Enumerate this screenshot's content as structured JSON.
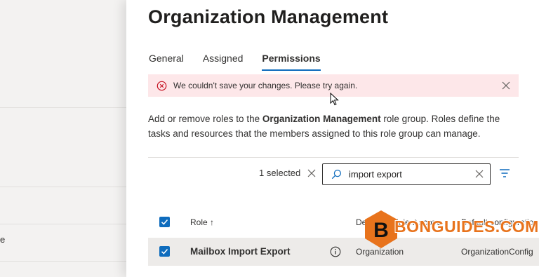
{
  "background_page": {
    "partial_text": "e"
  },
  "panel": {
    "title": "Organization Management",
    "tabs": [
      {
        "label": "General",
        "active": false
      },
      {
        "label": "Assigned",
        "active": false
      },
      {
        "label": "Permissions",
        "active": true
      }
    ],
    "error": {
      "message": "We couldn't save your changes. Please try again."
    },
    "description": {
      "prefix": "Add or remove roles to the ",
      "bold": "Organization Management",
      "suffix": " role group. Roles define the tasks and resources that the members assigned to this role group can manage."
    },
    "toolbar": {
      "selected_text": "1 selected",
      "search_value": "import export"
    },
    "table": {
      "headers": {
        "role": "Role ↑",
        "scope": "Default recipient scope",
        "config": "Default configuration"
      },
      "rows": [
        {
          "role": "Mailbox Import Export",
          "scope": "Organization",
          "config": "OrganizationConfig",
          "selected": true
        }
      ]
    }
  },
  "watermark": {
    "text": "BONGUIDES.COM",
    "letter": "B"
  },
  "colors": {
    "accent": "#0f6cbd",
    "error_bg": "#fde7e9",
    "error_icon": "#c50f1f",
    "watermark": "#e8731c"
  }
}
